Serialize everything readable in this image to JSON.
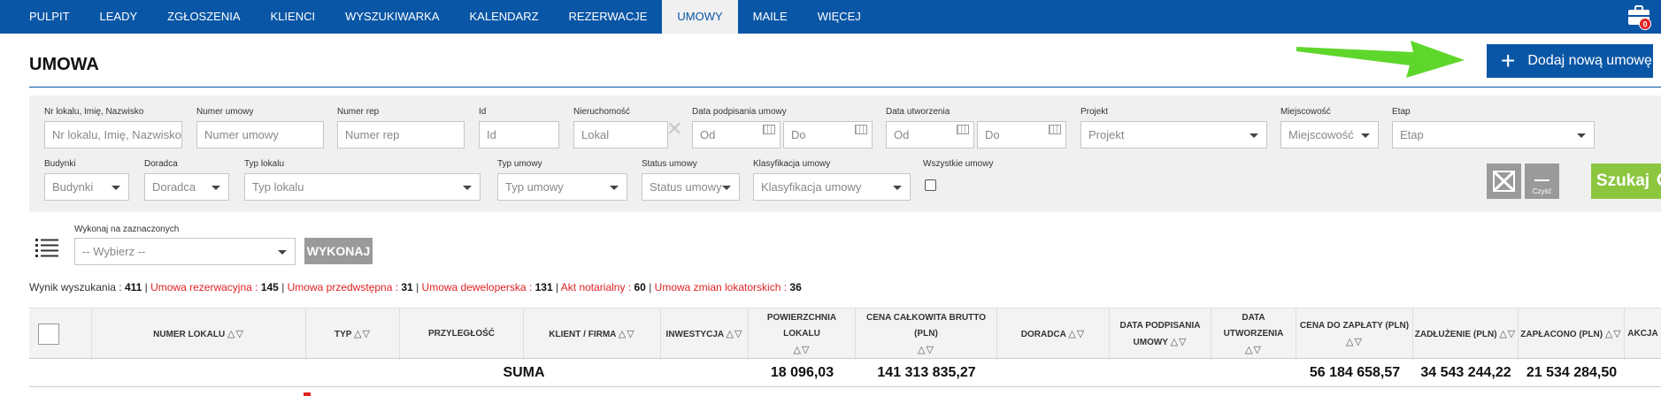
{
  "nav": {
    "items": [
      "PULPIT",
      "LEADY",
      "ZGŁOSZENIA",
      "KLIENCI",
      "WYSZUKIWARKA",
      "KALENDARZ",
      "REZERWACJE",
      "UMOWY",
      "MAILE",
      "WIĘCEJ"
    ],
    "active": "UMOWY",
    "badge": "0"
  },
  "header": {
    "title": "UMOWA",
    "add_button": "Dodaj nową umowę"
  },
  "filters": {
    "nr_lokalu": {
      "label": "Nr lokalu, Imię, Nazwisko",
      "placeholder": "Nr lokalu, Imię, Nazwisko"
    },
    "numer_umowy": {
      "label": "Numer umowy",
      "placeholder": "Numer umowy"
    },
    "numer_rep": {
      "label": "Numer rep",
      "placeholder": "Numer rep"
    },
    "id": {
      "label": "Id",
      "placeholder": "Id"
    },
    "nieruchomosc": {
      "label": "Nieruchomość",
      "placeholder": "Lokal"
    },
    "data_podpisania": {
      "label": "Data podpisania umowy",
      "from": "Od",
      "to": "Do"
    },
    "data_utworzenia": {
      "label": "Data utworzenia",
      "from": "Od",
      "to": "Do"
    },
    "projekt": {
      "label": "Projekt",
      "value": "Projekt"
    },
    "miejscowosc": {
      "label": "Miejscowość",
      "value": "Miejscowość"
    },
    "etap": {
      "label": "Etap",
      "value": "Etap"
    },
    "budynki": {
      "label": "Budynki",
      "value": "Budynki"
    },
    "doradca": {
      "label": "Doradca",
      "value": "Doradca"
    },
    "typ_lokalu": {
      "label": "Typ lokalu",
      "value": "Typ lokalu"
    },
    "typ_umowy": {
      "label": "Typ umowy",
      "value": "Typ umowy"
    },
    "status_umowy": {
      "label": "Status umowy",
      "value": "Status umowy"
    },
    "klasyfikacja": {
      "label": "Klasyfikacja umowy",
      "value": "Klasyfikacja umowy"
    },
    "wszystkie": {
      "label": "Wszystkie umowy",
      "checked": false
    },
    "clear_label": "Czyść",
    "search_label": "Szukaj"
  },
  "bulk": {
    "label": "Wykonaj na zaznaczonych",
    "select_value": "-- Wybierz --",
    "button": "WYKONAJ"
  },
  "stats": {
    "wynik_label": "Wynik wyszukania :",
    "wynik_value": "411",
    "items": [
      {
        "label": "Umowa rezerwacyjna :",
        "value": "145"
      },
      {
        "label": "Umowa przedwstępna :",
        "value": "31"
      },
      {
        "label": "Umowa deweloperska :",
        "value": "131"
      },
      {
        "label": "Akt notarialny :",
        "value": "60"
      },
      {
        "label": "Umowa zmian lokatorskich :",
        "value": "36"
      }
    ]
  },
  "table": {
    "columns": [
      {
        "l1": "NUMER LOKALU",
        "l2": ""
      },
      {
        "l1": "TYP",
        "l2": ""
      },
      {
        "l1": "PRZYLEGŁOŚĆ",
        "l2": ""
      },
      {
        "l1": "KLIENT / FIRMA",
        "l2": ""
      },
      {
        "l1": "INWESTYCJA",
        "l2": ""
      },
      {
        "l1": "POWIERZCHNIA LOKALU",
        "l2": ""
      },
      {
        "l1": "CENA CAŁKOWITA BRUTTO (PLN)",
        "l2": ""
      },
      {
        "l1": "DORADCA",
        "l2": ""
      },
      {
        "l1": "DATA PODPISANIA",
        "l2": "UMOWY"
      },
      {
        "l1": "DATA UTWORZENIA",
        "l2": ""
      },
      {
        "l1": "CENA DO ZAPŁATY (PLN)",
        "l2": ""
      },
      {
        "l1": "ZADŁUŻENIE (PLN)",
        "l2": ""
      },
      {
        "l1": "ZAPŁACONO (PLN)",
        "l2": ""
      },
      {
        "l1": "AKCJA",
        "l2": ""
      }
    ],
    "sum": {
      "label": "SUMA",
      "powierzchnia": "18 096,03",
      "cena_calkowita": "141 313 835,27",
      "cena_do_zaplaty": "56 184 658,57",
      "zadluzenie": "34 543 244,22",
      "zaplacono": "21 534 284,50"
    }
  },
  "colors": {
    "primary": "#0a56a6",
    "green": "#8cc63f",
    "red": "#e02222",
    "grey": "#9a9a9a"
  }
}
